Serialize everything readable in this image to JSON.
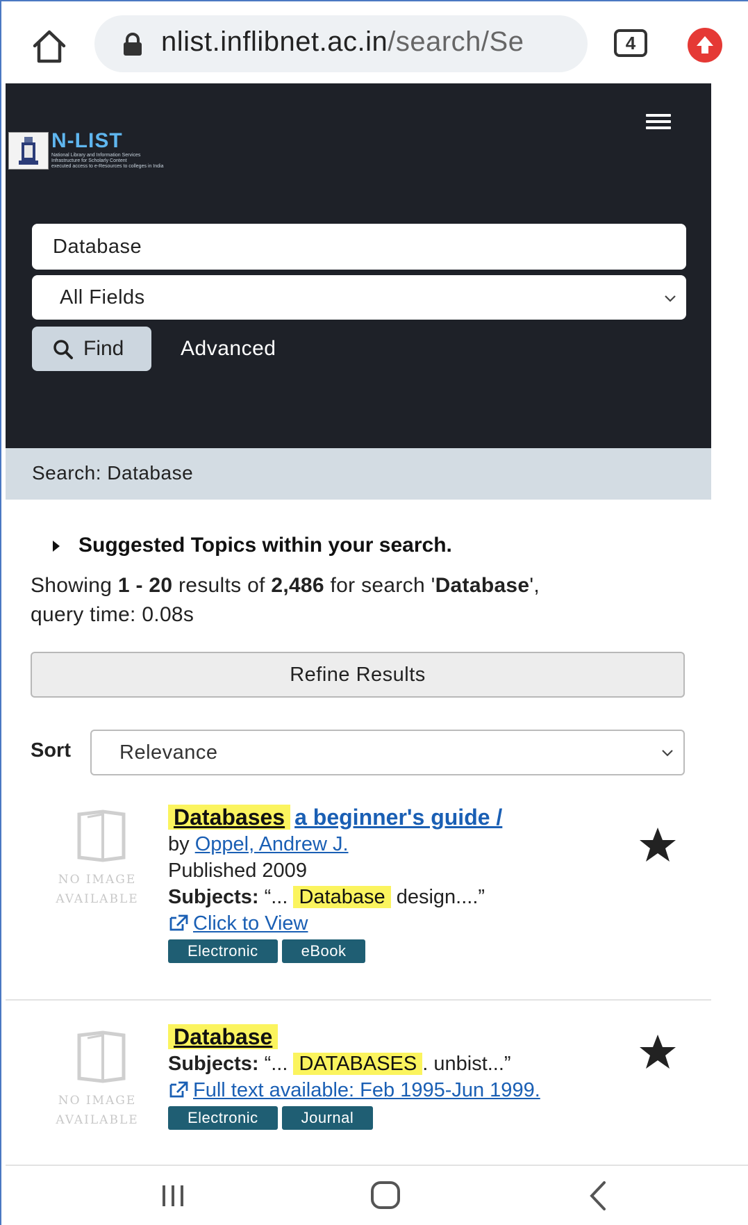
{
  "browser": {
    "url_host": "nlist.inflibnet.ac.in",
    "url_path": "/search/Se",
    "tab_count": "4",
    "icons": {
      "home": "home-icon",
      "lock": "lock-icon",
      "tabs": "tabs-icon",
      "update": "update-arrow-icon"
    }
  },
  "site": {
    "logo_title": "N-LIST",
    "logo_sub_1": "National Library and Information Services",
    "logo_sub_2": "Infrastructure for Scholarly Content",
    "logo_sub_3": "executed access to e-Resources to colleges in India",
    "brand_color": "#5fb6ef",
    "header_bg": "#1e2128"
  },
  "search": {
    "query": "Database",
    "field_type": "All Fields",
    "find_label": "Find",
    "advanced_label": "Advanced"
  },
  "breadcrumb": {
    "text": "Search: Database"
  },
  "results_meta": {
    "suggested_label": "Suggested Topics within your search.",
    "showing_prefix": "Showing ",
    "range": "1 - 20",
    "results_of": " results of ",
    "total": "2,486",
    "for_search": " for search '",
    "query": "Database",
    "query_suffix": "',",
    "query_time": "query time: 0.08s"
  },
  "refine_label": "Refine Results",
  "sort": {
    "label": "Sort",
    "value": "Relevance"
  },
  "results": [
    {
      "title_highlight": "Databases",
      "title_rest": "a beginner's guide /",
      "by_label": "by ",
      "author": "Oppel, Andrew J.",
      "published": "Published 2009",
      "subjects_label": "Subjects:",
      "subjects_pre": " “... ",
      "subjects_highlight": "Database",
      "subjects_post": " design....”",
      "link_text": "Click to View",
      "badges": [
        "Electronic",
        "eBook"
      ],
      "no_image_1": "NO IMAGE",
      "no_image_2": "AVAILABLE"
    },
    {
      "title_highlight": "Database",
      "subjects_label": "Subjects:",
      "subjects_pre": " “... ",
      "subjects_highlight": "DATABASES",
      "subjects_post": ". unbist...”",
      "link_text": "Full text available: Feb 1995-Jun 1999.",
      "badges": [
        "Electronic",
        "Journal"
      ],
      "no_image_1": "NO IMAGE",
      "no_image_2": "AVAILABLE"
    }
  ],
  "colors": {
    "highlight": "#fbf45e",
    "link": "#1a5fb4",
    "badge": "#1f5e73",
    "crumb_bg": "#d3dce3"
  }
}
